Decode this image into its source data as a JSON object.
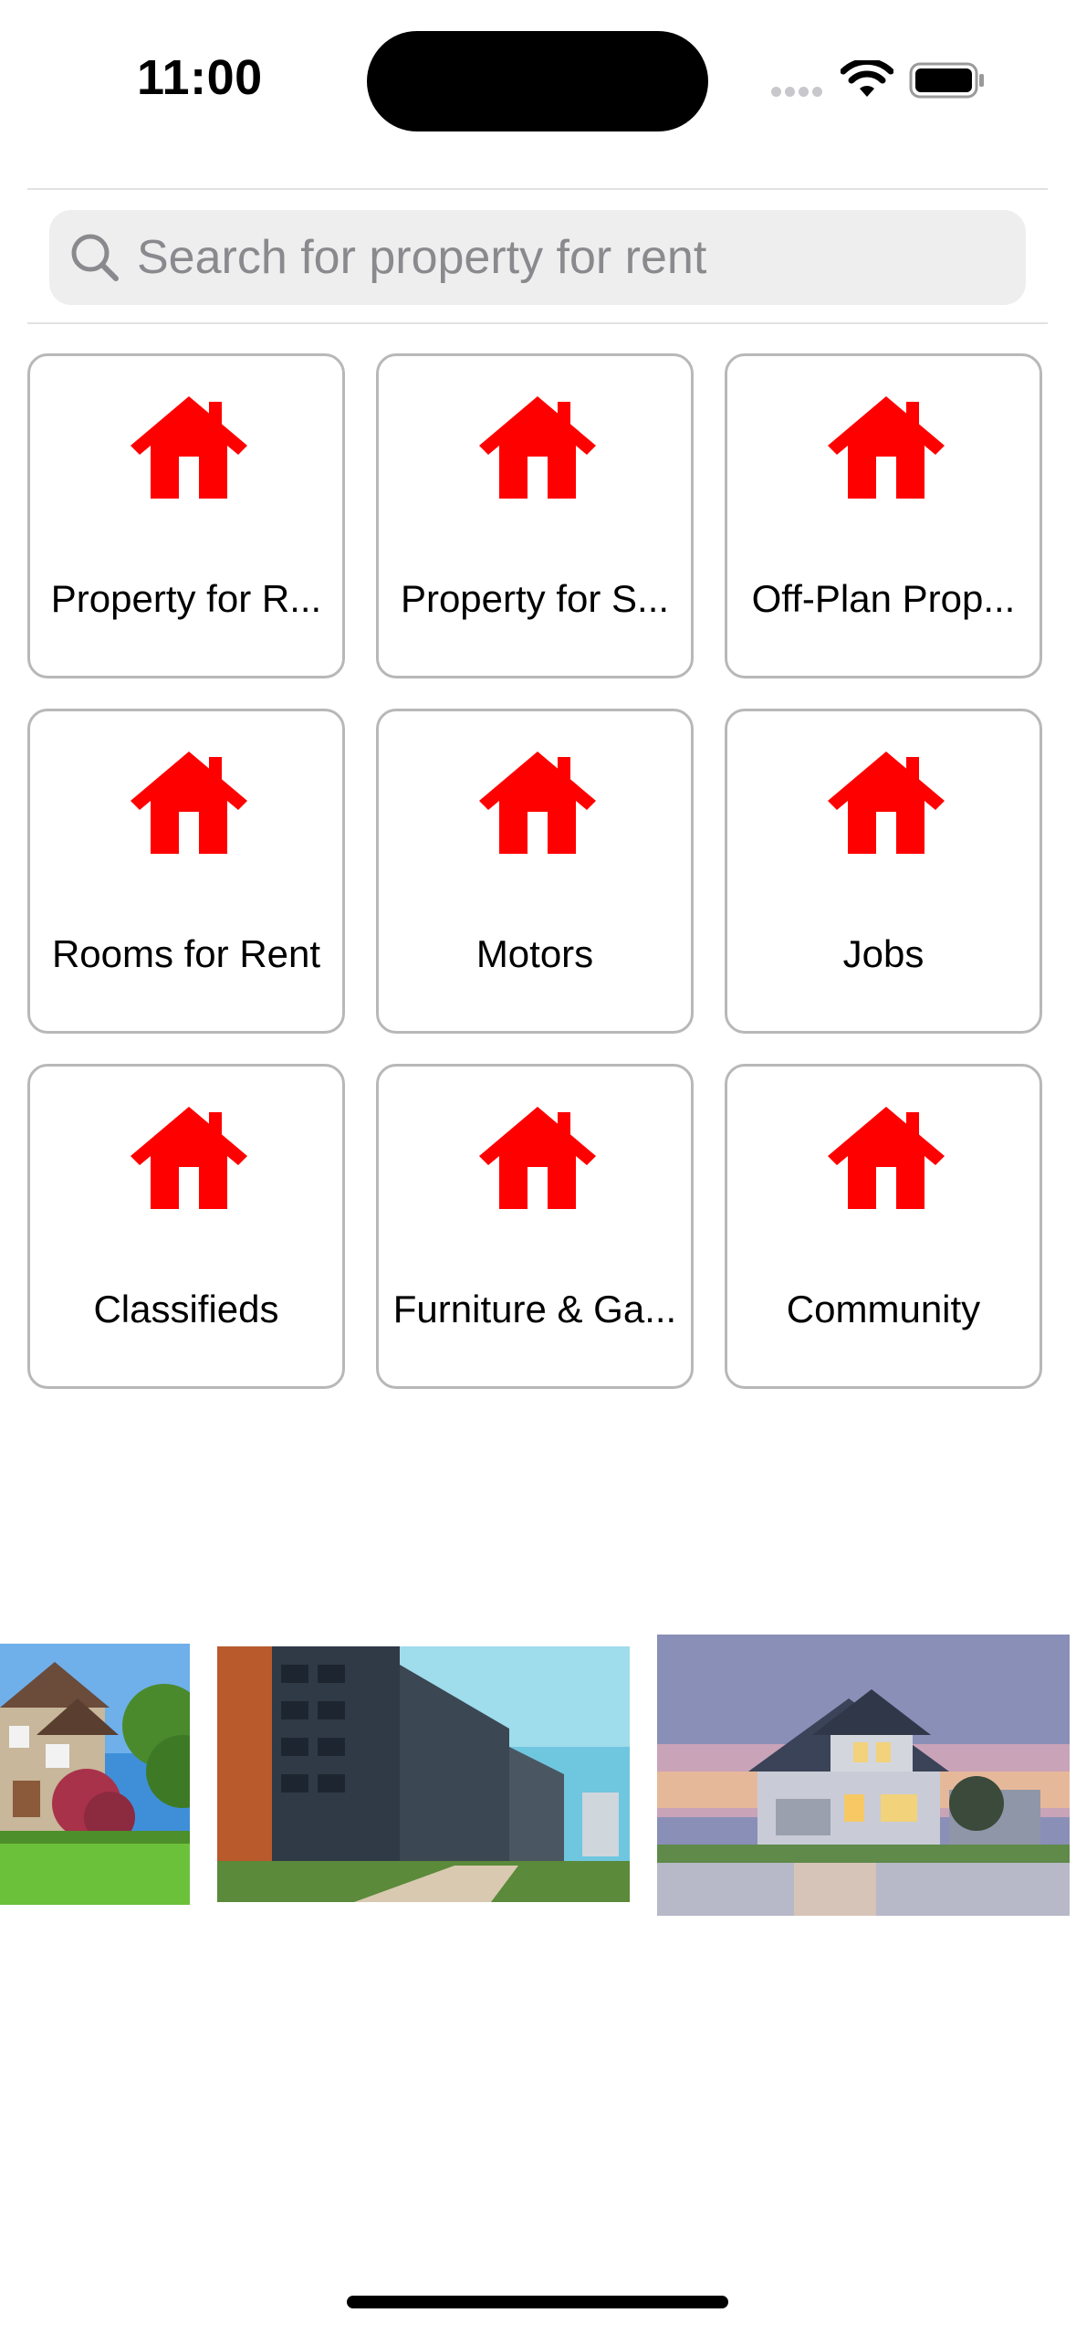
{
  "status_bar": {
    "time": "11:00"
  },
  "search": {
    "placeholder": "Search for property for rent",
    "value": ""
  },
  "categories": [
    {
      "label": "Property for R...",
      "icon": "house-icon"
    },
    {
      "label": "Property for S...",
      "icon": "house-icon"
    },
    {
      "label": "Off-Plan Prop...",
      "icon": "house-icon"
    },
    {
      "label": "Rooms for Rent",
      "icon": "house-icon"
    },
    {
      "label": "Motors",
      "icon": "house-icon"
    },
    {
      "label": "Jobs",
      "icon": "house-icon"
    },
    {
      "label": "Classifieds",
      "icon": "house-icon"
    },
    {
      "label": "Furniture & Ga...",
      "icon": "house-icon"
    },
    {
      "label": "Community",
      "icon": "house-icon"
    }
  ],
  "colors": {
    "accent": "#ff0000",
    "tile_border": "#b8b8b8",
    "search_bg": "#eeeeef"
  }
}
